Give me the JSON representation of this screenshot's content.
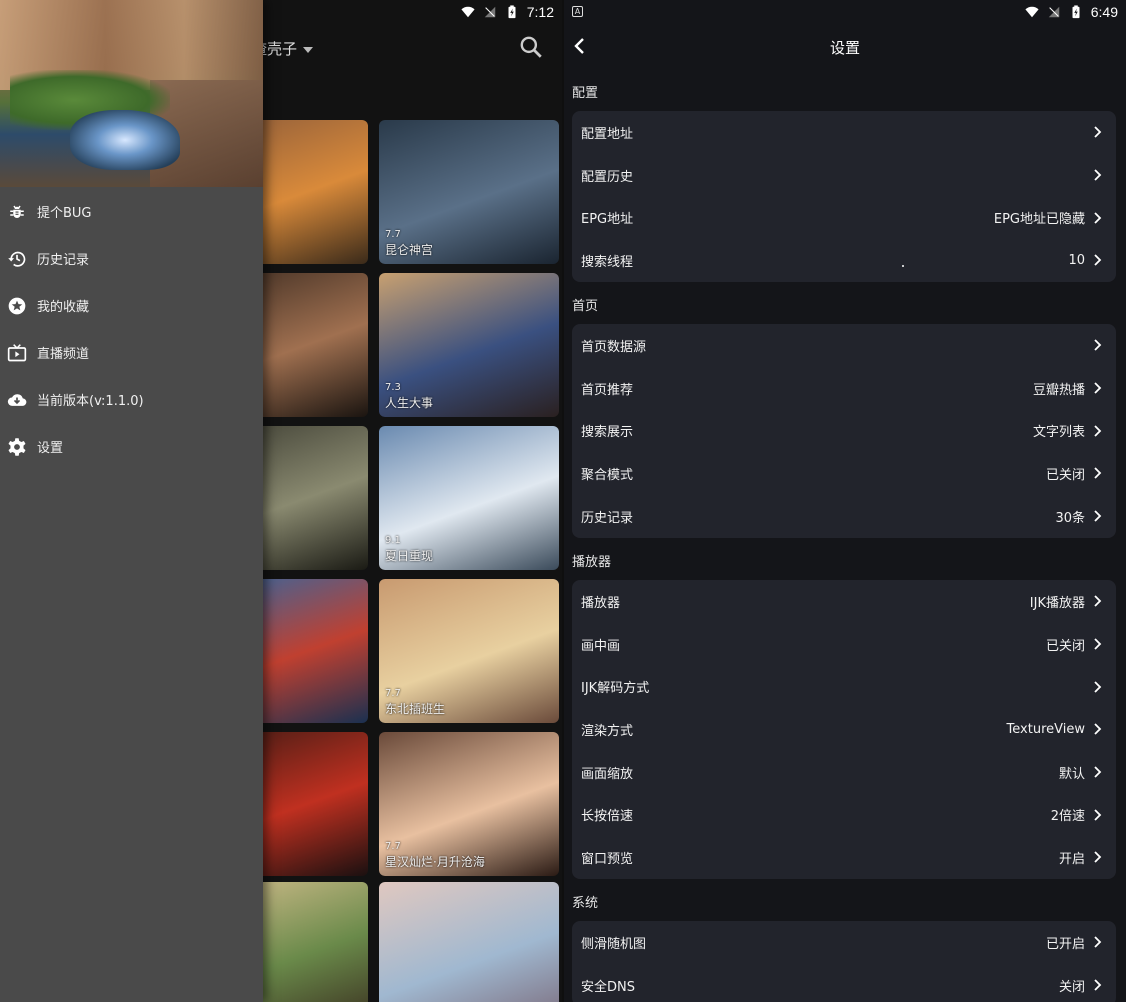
{
  "left": {
    "status": {
      "time": "7:12"
    },
    "app_title_partial": "渣壳子",
    "drawer": {
      "items": [
        {
          "label": "提个BUG",
          "icon": "bug-icon"
        },
        {
          "label": "历史记录",
          "icon": "history-icon"
        },
        {
          "label": "我的收藏",
          "icon": "star-icon"
        },
        {
          "label": "直播频道",
          "icon": "tv-icon"
        },
        {
          "label": "当前版本(v:1.1.0)",
          "icon": "cloud-download-icon"
        },
        {
          "label": "设置",
          "icon": "gear-icon"
        }
      ]
    },
    "cards": [
      {
        "title": "",
        "rating": ""
      },
      {
        "title": "昆仑神宫",
        "rating": "7.7"
      },
      {
        "title": "",
        "rating": ""
      },
      {
        "title": "人生大事",
        "rating": "7.3"
      },
      {
        "title": "",
        "rating": ""
      },
      {
        "title": "夏日重现",
        "rating": "9.1"
      },
      {
        "title": "",
        "rating": ""
      },
      {
        "title": "东北插班生",
        "rating": "7.7"
      },
      {
        "title": "",
        "rating": ""
      },
      {
        "title": "星汉灿烂·月升沧海",
        "rating": "7.7"
      },
      {
        "title": "",
        "rating": ""
      },
      {
        "title": "",
        "rating": ""
      }
    ]
  },
  "right": {
    "status": {
      "time": "6:49"
    },
    "title": "设置",
    "sections": [
      {
        "label": "配置",
        "rows": [
          {
            "label": "配置地址",
            "value": ""
          },
          {
            "label": "配置历史",
            "value": ""
          },
          {
            "label": "EPG地址",
            "value": "EPG地址已隐藏"
          },
          {
            "label": "搜索线程",
            "value": "10"
          }
        ]
      },
      {
        "label": "首页",
        "rows": [
          {
            "label": "首页数据源",
            "value": ""
          },
          {
            "label": "首页推荐",
            "value": "豆瓣热播"
          },
          {
            "label": "搜索展示",
            "value": "文字列表"
          },
          {
            "label": "聚合模式",
            "value": "已关闭"
          },
          {
            "label": "历史记录",
            "value": "30条"
          }
        ]
      },
      {
        "label": "播放器",
        "rows": [
          {
            "label": "播放器",
            "value": "IJK播放器"
          },
          {
            "label": "画中画",
            "value": "已关闭"
          },
          {
            "label": "IJK解码方式",
            "value": ""
          },
          {
            "label": "渲染方式",
            "value": "TextureView"
          },
          {
            "label": "画面缩放",
            "value": "默认"
          },
          {
            "label": "长按倍速",
            "value": "2倍速"
          },
          {
            "label": "窗口预览",
            "value": "开启"
          }
        ]
      },
      {
        "label": "系统",
        "rows": [
          {
            "label": "侧滑随机图",
            "value": "已开启"
          },
          {
            "label": "安全DNS",
            "value": "关闭"
          }
        ]
      }
    ]
  },
  "colors": {
    "drawer_bg": "#4a4a4a",
    "settings_bg": "#141519",
    "group_bg": "#22242c"
  }
}
